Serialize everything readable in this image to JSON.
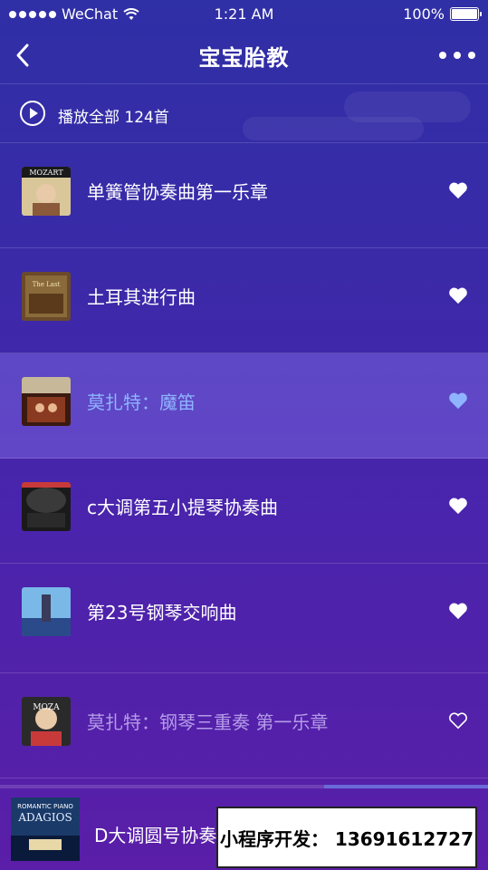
{
  "status_bar": {
    "carrier": "WeChat",
    "time": "1:21 AM",
    "battery": "100%"
  },
  "nav": {
    "title": "宝宝胎教"
  },
  "play_all": {
    "label": "播放全部 124首"
  },
  "songs": [
    {
      "title": "单簧管协奏曲第一乐章",
      "state": "normal",
      "favorited": true
    },
    {
      "title": "土耳其进行曲",
      "state": "normal",
      "favorited": true
    },
    {
      "title": "莫扎特：魔笛",
      "state": "playing",
      "favorited": true
    },
    {
      "title": "c大调第五小提琴协奏曲",
      "state": "normal",
      "favorited": true
    },
    {
      "title": "第23号钢琴交响曲",
      "state": "normal",
      "favorited": true
    },
    {
      "title": "莫扎特：钢琴三重奏 第一乐章",
      "state": "dim",
      "favorited": false
    }
  ],
  "player": {
    "title": "D大调圆号协奏曲",
    "progress": 0.34
  },
  "promo": {
    "text": "小程序开发：  13691612727"
  },
  "colors": {
    "background_top": "#2f2fa6",
    "background_bottom": "#5a1ea8",
    "highlight_text": "#8fb4ff",
    "dim_text": "#b59be8",
    "active_row": "#6e5ed8"
  }
}
